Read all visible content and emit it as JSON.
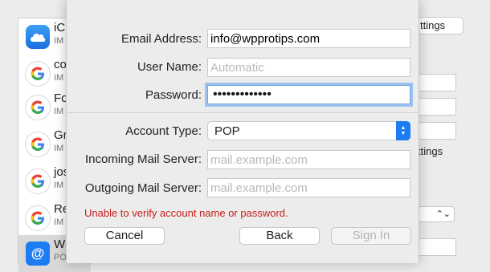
{
  "background": {
    "accounts": [
      {
        "name": "iCl",
        "sub": "IM",
        "icon": "icloud-icon"
      },
      {
        "name": "co",
        "sub": "IM",
        "icon": "google-icon"
      },
      {
        "name": "Fo",
        "sub": "IM",
        "icon": "google-icon"
      },
      {
        "name": "Gr",
        "sub": "IM",
        "icon": "google-icon"
      },
      {
        "name": "jos",
        "sub": "IM",
        "icon": "google-icon"
      },
      {
        "name": "Re",
        "sub": "IM",
        "icon": "google-icon"
      },
      {
        "name": "Wp",
        "sub": "PO",
        "icon": "mail-icon"
      }
    ],
    "settings_button": "ttings",
    "settings_text": "ttings"
  },
  "form": {
    "email_label": "Email Address:",
    "email_value": "info@wpprotips.com",
    "username_label": "User Name:",
    "username_placeholder": "Automatic",
    "password_label": "Password:",
    "password_value": "•••••••••••••",
    "account_type_label": "Account Type:",
    "account_type_value": "POP",
    "incoming_label": "Incoming Mail Server:",
    "incoming_placeholder": "mail.example.com",
    "outgoing_label": "Outgoing Mail Server:",
    "outgoing_placeholder": "mail.example.com",
    "error": "Unable to verify account name or password."
  },
  "buttons": {
    "cancel": "Cancel",
    "back": "Back",
    "sign_in": "Sign In"
  },
  "colors": {
    "error": "#c4201c",
    "accent": "#1e7cf2",
    "google_blue": "#4285f4",
    "google_red": "#ea4335",
    "google_yellow": "#fbbc05",
    "google_green": "#34a853"
  }
}
